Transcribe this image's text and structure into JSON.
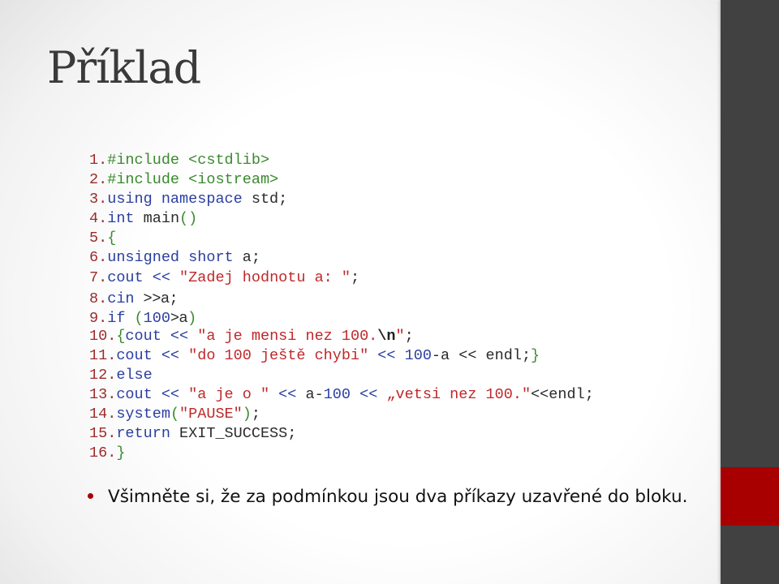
{
  "slide": {
    "title": "Příklad",
    "colors": {
      "sidebar": "#414141",
      "accent": "#a80000",
      "line_number": "#9c2b2b",
      "keyword": "#2b3fa0",
      "string": "#c0282a",
      "preprocessor": "#3a8a2e"
    },
    "code_lines": [
      [
        {
          "t": "ln",
          "v": "1."
        },
        {
          "t": "pp",
          "v": "#include <cstdlib>"
        }
      ],
      [
        {
          "t": "ln",
          "v": "2."
        },
        {
          "t": "pp",
          "v": "#include <iostream>"
        }
      ],
      [
        {
          "t": "ln",
          "v": "3."
        },
        {
          "t": "kw",
          "v": "using namespace"
        },
        {
          "t": "plain",
          "v": " std;"
        }
      ],
      [
        {
          "t": "ln",
          "v": "4."
        },
        {
          "t": "kw",
          "v": "int"
        },
        {
          "t": "plain",
          "v": " main"
        },
        {
          "t": "br",
          "v": "()"
        }
      ],
      [
        {
          "t": "ln",
          "v": "5."
        },
        {
          "t": "br",
          "v": "{"
        }
      ],
      [
        {
          "t": "ln",
          "v": "6."
        },
        {
          "t": "kw",
          "v": "unsigned short"
        },
        {
          "t": "plain",
          "v": " a;"
        }
      ],
      [
        {
          "t": "ln",
          "v": "7."
        },
        {
          "t": "kw",
          "v": "cout <<"
        },
        {
          "t": "plain",
          "v": " "
        },
        {
          "t": "str",
          "v": "\"Zadej hodnotu a: \""
        },
        {
          "t": "plain",
          "v": ";"
        }
      ],
      [
        {
          "t": "ln",
          "v": "8."
        },
        {
          "t": "kw",
          "v": "cin"
        },
        {
          "t": "plain",
          "v": " "
        },
        {
          "t": "sans",
          "v": ">>a"
        },
        {
          "t": "plain",
          "v": ";"
        }
      ],
      [
        {
          "t": "ln",
          "v": "9."
        },
        {
          "t": "kw",
          "v": "if"
        },
        {
          "t": "plain",
          "v": " "
        },
        {
          "t": "br",
          "v": "("
        },
        {
          "t": "num",
          "v": "100"
        },
        {
          "t": "sans",
          "v": ">a"
        },
        {
          "t": "br",
          "v": ")"
        }
      ],
      [
        {
          "t": "ln",
          "v": "10."
        },
        {
          "t": "br",
          "v": "{"
        },
        {
          "t": "kw",
          "v": "cout <<"
        },
        {
          "t": "plain",
          "v": " "
        },
        {
          "t": "str",
          "v": "\"a je mensi nez 100."
        },
        {
          "t": "esc",
          "v": "\\n"
        },
        {
          "t": "str",
          "v": "\""
        },
        {
          "t": "plain",
          "v": ";"
        }
      ],
      [
        {
          "t": "ln",
          "v": "11."
        },
        {
          "t": "kw",
          "v": "cout <<"
        },
        {
          "t": "plain",
          "v": " "
        },
        {
          "t": "str",
          "v": "\"do 100 ještě chybi\""
        },
        {
          "t": "kw",
          "v": " << "
        },
        {
          "t": "num",
          "v": "100"
        },
        {
          "t": "plain",
          "v": "-a << endl;"
        },
        {
          "t": "br",
          "v": "}"
        }
      ],
      [
        {
          "t": "ln",
          "v": "12."
        },
        {
          "t": "kw",
          "v": "else"
        }
      ],
      [
        {
          "t": "ln",
          "v": "13."
        },
        {
          "t": "kw",
          "v": "cout <<"
        },
        {
          "t": "plain",
          "v": " "
        },
        {
          "t": "str",
          "v": "\"a je o \""
        },
        {
          "t": "kw",
          "v": " << "
        },
        {
          "t": "plain",
          "v": "a-"
        },
        {
          "t": "num",
          "v": "100"
        },
        {
          "t": "kw",
          "v": " << "
        },
        {
          "t": "str",
          "v": "„vetsi nez 100.\""
        },
        {
          "t": "plain",
          "v": "<<endl;"
        }
      ],
      [
        {
          "t": "ln",
          "v": "14."
        },
        {
          "t": "kw",
          "v": "system"
        },
        {
          "t": "br",
          "v": "("
        },
        {
          "t": "str",
          "v": "\"PAUSE\""
        },
        {
          "t": "br",
          "v": ")"
        },
        {
          "t": "plain",
          "v": ";"
        }
      ],
      [
        {
          "t": "ln",
          "v": "15."
        },
        {
          "t": "kw",
          "v": "return"
        },
        {
          "t": "plain",
          "v": " EXIT_SUCCESS;"
        }
      ],
      [
        {
          "t": "ln",
          "v": "16."
        },
        {
          "t": "br",
          "v": "}"
        }
      ]
    ],
    "bullet": "Všimněte si, že za podmínkou jsou dva příkazy uzavřené do bloku."
  }
}
